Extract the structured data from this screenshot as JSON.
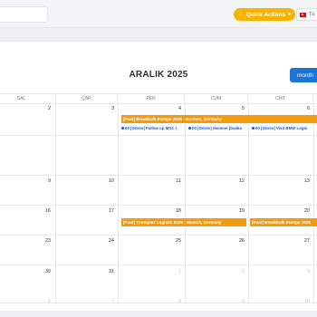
{
  "topbar": {
    "quick_actions_label": "Quick Actions",
    "lang_label": "Tü"
  },
  "calendar": {
    "title": "ARALIK 2025",
    "view_button": "month",
    "weekdays": [
      "SAL",
      "ÇAR",
      "PER",
      "CUM",
      "CMT"
    ],
    "weeks": [
      [
        "2",
        "3",
        "4",
        "5",
        "6"
      ],
      [
        "9",
        "10",
        "11",
        "12",
        "13"
      ],
      [
        "16",
        "17",
        "18",
        "19",
        "20"
      ],
      [
        "23",
        "24",
        "25",
        "26",
        "27"
      ],
      [
        "30",
        "31",
        "1",
        "2",
        "3"
      ],
      [
        "6",
        "7",
        "8",
        "9",
        "10"
      ]
    ],
    "events": {
      "breakbulk_bremen": "[Fuar] Breakbulk Europe 2025 - Bremen, Germany",
      "transport_munich": "[Fuar] Transport Logistic 2025 - Munich, Germany",
      "breakbulk_right": "[Fuar] Breakbulk Europe 2025"
    },
    "tasks": {
      "t1": "00 [Görev] Follow up MSC I",
      "t2": "00 [Görev] deneme (bueka",
      "t3": "00 [Görev] Visit BMW Logis"
    }
  }
}
